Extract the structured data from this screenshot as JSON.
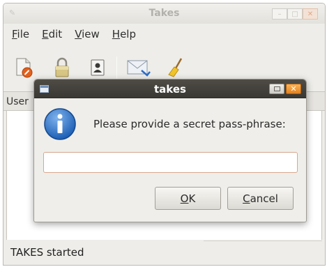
{
  "window": {
    "title": "Takes",
    "controls": {
      "minimize_icon": "minimize-icon",
      "maximize_icon": "maximize-icon",
      "close_icon": "close-icon"
    }
  },
  "menu": {
    "items": [
      {
        "label": "File",
        "mnemonic_index": 0
      },
      {
        "label": "Edit",
        "mnemonic_index": 0
      },
      {
        "label": "View",
        "mnemonic_index": 0
      },
      {
        "label": "Help",
        "mnemonic_index": 0
      }
    ]
  },
  "toolbar": {
    "buttons": [
      {
        "icon": "new-document-icon"
      },
      {
        "icon": "lock-icon"
      },
      {
        "icon": "contact-icon"
      },
      {
        "icon": "mail-icon"
      },
      {
        "icon": "broom-icon"
      }
    ]
  },
  "content": {
    "header_label": "User"
  },
  "status": {
    "text": "TAKES started"
  },
  "dialog": {
    "title": "takes",
    "message": "Please provide a secret pass-phrase:",
    "input_value": "",
    "ok_label": "OK",
    "cancel_label": "Cancel",
    "icon": "info-icon"
  },
  "colors": {
    "dialog_titlebar": "#3a3833",
    "close_button": "#e5831f",
    "info_blue": "#2f73c8",
    "input_border": "#d6a78e"
  }
}
